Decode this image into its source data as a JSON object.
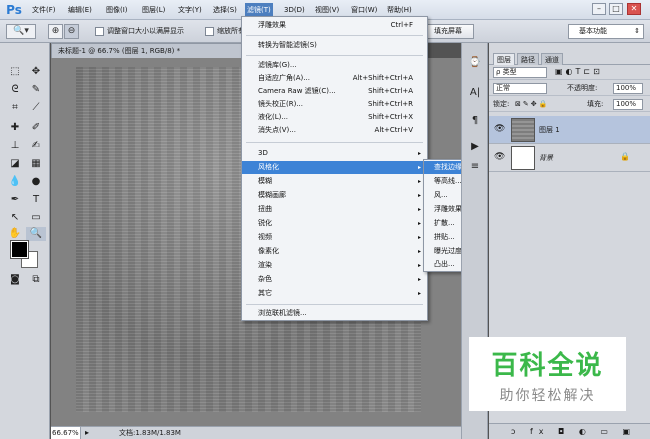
{
  "app": {
    "logo": "Ps"
  },
  "menubar": {
    "items": [
      "文件(F)",
      "编辑(E)",
      "图像(I)",
      "图层(L)",
      "文字(Y)",
      "选择(S)",
      "滤镜(T)",
      "3D(D)",
      "视图(V)",
      "窗口(W)",
      "帮助(H)"
    ],
    "active_index": 6
  },
  "window_controls": {
    "minimize": "–",
    "maximize": "□",
    "close": "✕"
  },
  "options": {
    "resize_windows_label": "调整窗口大小以满屏显示",
    "zoom_all_label": "缩放所有",
    "fill_screen_button": "填充屏幕",
    "workspace": "基本功能"
  },
  "document": {
    "tab_title": "未标题-1 @ 66.7% (图层 1, RGB/8) *",
    "tab_close": "×",
    "zoom": "66.67%",
    "doc_info": "文档:1.83M/1.83M",
    "status_arrow": "▸"
  },
  "filter_menu": {
    "last_filter": {
      "label": "浮雕效果",
      "shortcut": "Ctrl+F"
    },
    "convert_smart": "转换为智能滤镜(S)",
    "items_with_shortcuts": [
      {
        "label": "滤镜库(G)...",
        "shortcut": ""
      },
      {
        "label": "自适应广角(A)...",
        "shortcut": "Alt+Shift+Ctrl+A"
      },
      {
        "label": "Camera Raw 滤镜(C)...",
        "shortcut": "Shift+Ctrl+A"
      },
      {
        "label": "镜头校正(R)...",
        "shortcut": "Shift+Ctrl+R"
      },
      {
        "label": "液化(L)...",
        "shortcut": "Shift+Ctrl+X"
      },
      {
        "label": "消失点(V)...",
        "shortcut": "Alt+Ctrl+V"
      }
    ],
    "submenus": [
      "3D",
      "风格化",
      "模糊",
      "模糊画廊",
      "扭曲",
      "锐化",
      "视频",
      "像素化",
      "渲染",
      "杂色",
      "其它"
    ],
    "highlighted_submenu_index": 1,
    "browse_online": "浏览联机滤镜...",
    "arrow_glyph": "▸"
  },
  "stylize_submenu": {
    "items": [
      "查找边缘",
      "等高线...",
      "风...",
      "浮雕效果...",
      "扩散...",
      "拼贴...",
      "曝光过度",
      "凸出..."
    ],
    "highlighted_index": 0
  },
  "layers_panel": {
    "tabs": [
      "图层",
      "路径",
      "通道"
    ],
    "kind_filter": "ρ 类型",
    "blend_mode": "正常",
    "opacity_label": "不透明度:",
    "opacity_value": "100%",
    "lock_label": "锁定:",
    "fill_label": "填充:",
    "fill_value": "100%",
    "layers": [
      {
        "name": "图层 1",
        "selected": true
      },
      {
        "name": "背景",
        "selected": false,
        "locked": true
      }
    ],
    "bottom_icons": "ↄ fx ◘ ◐ ▭ ▣ 🗑"
  },
  "watermark": {
    "title": "百科全说",
    "subtitle": "助你轻松解决"
  },
  "colors": {
    "accent": "#3d83d6",
    "menu_active": "#4d7fbf",
    "watermark_green": "#3bb84a"
  }
}
